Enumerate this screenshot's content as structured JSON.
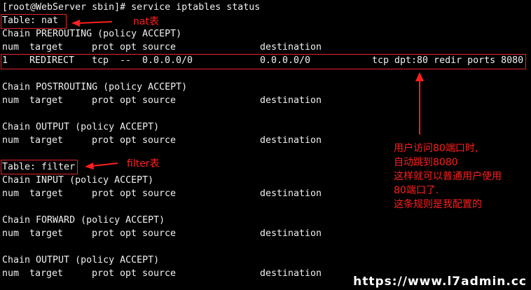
{
  "terminal": {
    "prompt_line": "[root@WebServer sbin]# service iptables status",
    "nat_table": {
      "title": "Table: nat",
      "prerouting": {
        "chain": "Chain PREROUTING (policy ACCEPT)",
        "header": [
          "num",
          "target",
          "prot",
          "opt",
          "source",
          "destination"
        ],
        "row": {
          "num": "1",
          "target": "REDIRECT",
          "prot": "tcp",
          "opt": "--",
          "source": "0.0.0.0/0",
          "destination": "0.0.0.0/0",
          "extra": "tcp dpt:80 redir ports 8080"
        }
      },
      "postrouting": {
        "chain": "Chain POSTROUTING (policy ACCEPT)",
        "header": [
          "num",
          "target",
          "prot",
          "opt",
          "source",
          "destination"
        ]
      },
      "output": {
        "chain": "Chain OUTPUT (policy ACCEPT)",
        "header": [
          "num",
          "target",
          "prot",
          "opt",
          "source",
          "destination"
        ]
      }
    },
    "filter_table": {
      "title": "Table: filter",
      "input": {
        "chain": "Chain INPUT (policy ACCEPT)",
        "header": [
          "num",
          "target",
          "prot",
          "opt",
          "source",
          "destination"
        ]
      },
      "forward": {
        "chain": "Chain FORWARD (policy ACCEPT)",
        "header": [
          "num",
          "target",
          "prot",
          "opt",
          "source",
          "destination"
        ]
      },
      "output": {
        "chain": "Chain OUTPUT (policy ACCEPT)",
        "header": [
          "num",
          "target",
          "prot",
          "opt",
          "source",
          "destination"
        ]
      }
    }
  },
  "annotations": {
    "nat_label": "nat表",
    "filter_label": "filter表",
    "note_lines": [
      "用户访问80端口时,",
      "自动跳到8080",
      "这样就可以普通用户使用",
      "80端口了.",
      "这条规则是我配置的"
    ],
    "color": "#ff1f1f"
  },
  "watermark": "https://www.l7admin.cc"
}
